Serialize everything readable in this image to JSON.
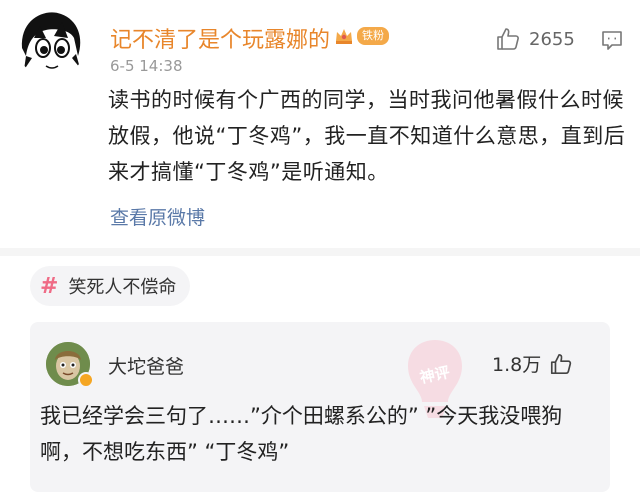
{
  "post": {
    "username": "记不清了是个玩露娜的",
    "fan_badge": "铁粉",
    "timestamp": "6-5 14:38",
    "like_count": "2655",
    "text": "读书的时候有个广西的同学，当时我问他暑假什么时候放假，他说“丁冬鸡”，我一直不知道什么意思，直到后来才搞懂“丁冬鸡”是听通知。",
    "view_original": "查看原微博"
  },
  "topic": {
    "label": "笑死人不偿命"
  },
  "comment": {
    "username": "大坨爸爸",
    "like_count": "1.8万",
    "text": "我已经学会三句了……”介个田螺系公的” ”今天我没喂狗啊，不想吃东西” “丁冬鸡”",
    "watermark": "神评"
  },
  "colors": {
    "username": "#e8862b",
    "link": "#5a79a8",
    "topic_hash": "#ef6b86",
    "badge": "#f4a949"
  }
}
